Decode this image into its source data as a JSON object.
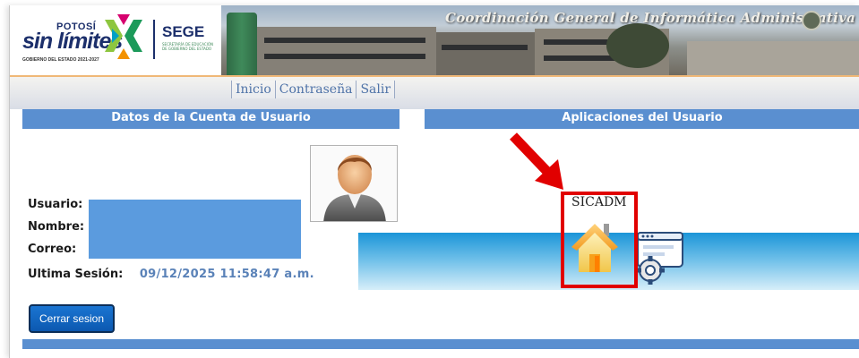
{
  "header": {
    "brand_small": "POTOSÍ",
    "brand_big": "sin límites",
    "brand_caption": "GOBIERNO DEL ESTADO 2021-2027",
    "org": "SEGE",
    "org_caption": "SECRETARÍA DE EDUCACIÓN DE GOBIERNO DEL ESTADO",
    "banner_title": "Coordinación General de Informática Administrativa"
  },
  "nav": {
    "items": [
      "Inicio",
      "Contraseña",
      "Salir"
    ]
  },
  "account": {
    "section_title": "Datos de la Cuenta de Usuario",
    "user_label": "Usuario:",
    "name_label": "Nombre:",
    "email_label": "Correo:",
    "last_session_label": "Ultima Sesión:",
    "last_session_value": "09/12/2025 11:58:47 a.m.",
    "logout_label": "Cerrar sesion"
  },
  "apps": {
    "section_title": "Aplicaciones del Usuario",
    "items": [
      {
        "name": "SICADM",
        "icon": "home-icon"
      }
    ]
  },
  "colors": {
    "section_header": "#5a8fd0",
    "highlight": "#e10000",
    "accent_orange": "#f0b877",
    "logout_button": "#1a75d2"
  }
}
